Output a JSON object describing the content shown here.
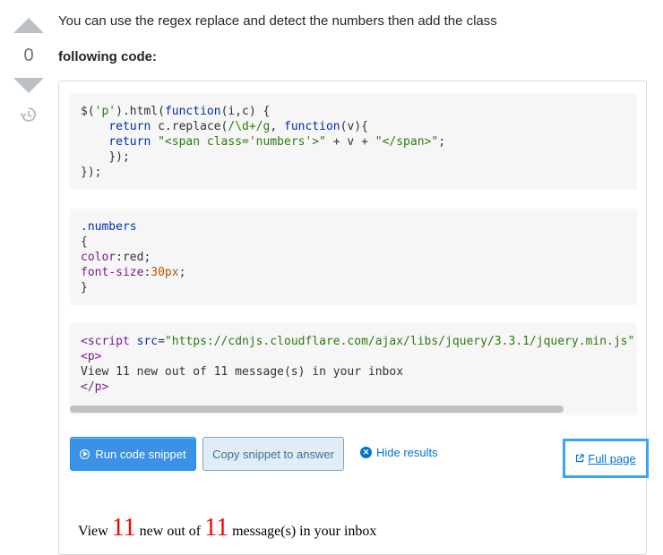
{
  "vote": {
    "count": "0"
  },
  "answer": {
    "intro": "You can use the regex replace and detect the numbers then add the class",
    "following": "following code:"
  },
  "snippet": {
    "js_lines": [
      "$('p').html(function(i,c) {",
      "    return c.replace(/\\d+/g, function(v){",
      "    return \"<span class='numbers'>\" + v + \"</span>\";",
      "    });",
      "});"
    ],
    "css_lines": [
      ".numbers",
      "{",
      "color:red;",
      "font-size:30px;",
      "}"
    ],
    "html_lines": [
      "<script src=\"https://cdnjs.cloudflare.com/ajax/libs/jquery/3.3.1/jquery.min.js\":",
      "<p>",
      "View 11 new out of 11 message(s) in your inbox",
      "</p>"
    ],
    "run_label": "Run code snippet",
    "copy_label": "Copy snippet to answer",
    "hide_label": "Hide results",
    "full_page_label": "Full page",
    "horizontal_scroll_fraction": 0.87
  },
  "result": {
    "prefix": "View ",
    "num1": "11",
    "mid": " new out of ",
    "num2": "11",
    "suffix": " message(s) in your inbox"
  },
  "colors": {
    "accent": "#0a95ff",
    "link": "#0074cc",
    "highlight_border": "#3fa3f0",
    "result_number": "#ff0000"
  },
  "icons": [
    "vote-up-icon",
    "vote-down-icon",
    "history-icon",
    "play-icon",
    "close-circle-icon",
    "external-link-icon"
  ]
}
